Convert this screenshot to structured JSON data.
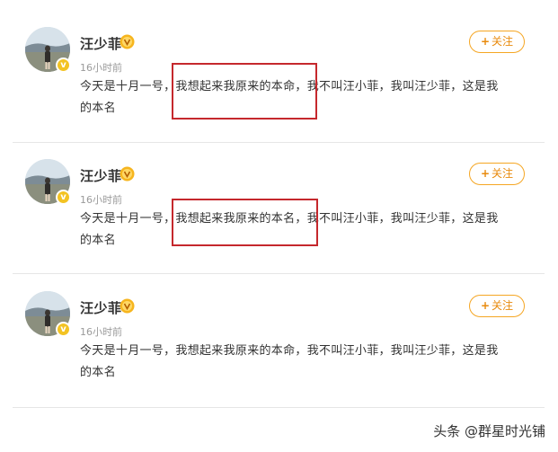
{
  "posts": [
    {
      "user_name": "汪少菲",
      "time": "16小时前",
      "text_line1": "今天是十月一号，我想起来我原来的本命，我不叫汪小菲，我叫汪少菲，这是我",
      "text_line2": "的本名",
      "follow_label": "关注",
      "follow_plus": "+"
    },
    {
      "user_name": "汪少菲",
      "time": "16小时前",
      "text_line1": "今天是十月一号，我想起来我原来的本名，我不叫汪小菲，我叫汪少菲，这是我",
      "text_line2": "的本名",
      "follow_label": "关注",
      "follow_plus": "+"
    },
    {
      "user_name": "汪少菲",
      "time": "16小时前",
      "text_line1": "今天是十月一号，我想起来我原来的本命，我不叫汪小菲，我叫汪少菲，这是我",
      "text_line2": "的本名",
      "follow_label": "关注",
      "follow_plus": "+"
    }
  ],
  "verified_badge": "v",
  "icons": {
    "verified": "verified-v-icon",
    "vip": "vip-badge-icon",
    "follow": "plus-icon"
  },
  "colors": {
    "accent_orange": "#f5a623",
    "highlight_red": "#c5282d",
    "verified_yellow": "#f3c323"
  },
  "watermark": "头条 @群星时光铺"
}
